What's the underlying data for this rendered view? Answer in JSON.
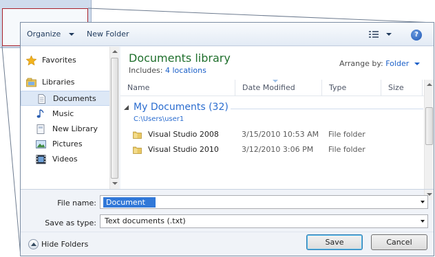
{
  "toolbar": {
    "organize_label": "Organize",
    "new_folder_label": "New Folder",
    "help_glyph": "?"
  },
  "nav": {
    "favorites_label": "Favorites",
    "libraries_label": "Libraries",
    "items": [
      {
        "label": "Documents",
        "icon": "document-icon",
        "selected": true
      },
      {
        "label": "Music",
        "icon": "music-note-icon"
      },
      {
        "label": "New Library",
        "icon": "library-icon"
      },
      {
        "label": "Pictures",
        "icon": "picture-icon"
      },
      {
        "label": "Videos",
        "icon": "film-icon"
      }
    ]
  },
  "content": {
    "library_title": "Documents library",
    "includes_prefix": "Includes:",
    "includes_link": "4 locations",
    "arrange_label": "Arrange by:",
    "arrange_value": "Folder",
    "columns": [
      "Name",
      "Date Modified",
      "Type",
      "Size"
    ],
    "group_title": "My Documents (32)",
    "group_path": "C:\\Users\\user1",
    "rows": [
      {
        "name": "Visual Studio 2008",
        "date": "3/15/2010 10:53 AM",
        "type": "File folder"
      },
      {
        "name": "Visual Studio 2010",
        "date": "3/12/2010 3:06 PM",
        "type": "File folder"
      }
    ]
  },
  "form": {
    "file_name_label": "File name:",
    "file_name_value": "Document",
    "save_type_label": "Save as type:",
    "save_type_value": "Text documents (.txt)"
  },
  "buttons": {
    "hide_folders_label": "Hide Folders",
    "save_label": "Save",
    "cancel_label": "Cancel"
  },
  "colors": {
    "library_title": "#1f6f2c",
    "link": "#1a5fc8",
    "selection": "#3178d8",
    "inset_border": "#a8202a"
  }
}
